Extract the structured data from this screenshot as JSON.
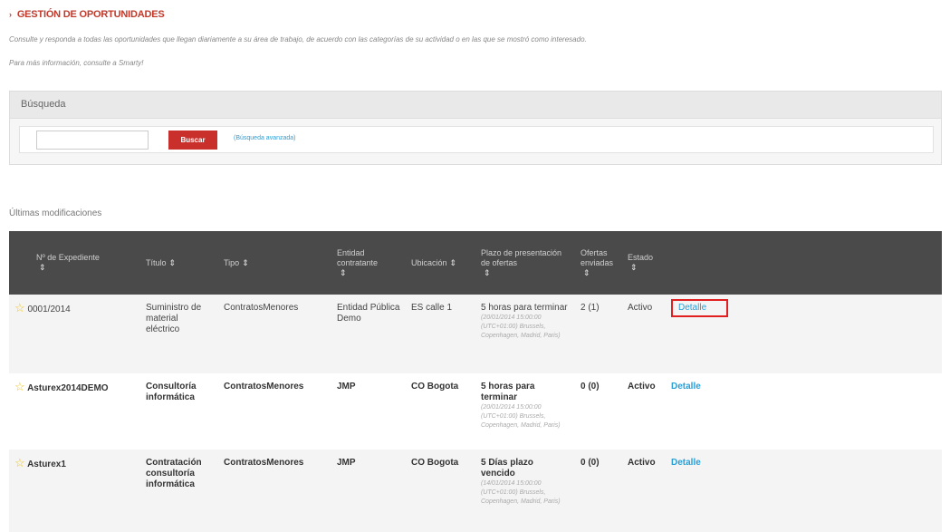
{
  "header": {
    "title": "GESTIÓN DE OPORTUNIDADES",
    "intro": "Consulte y responda a todas las oportunidades que llegan diariamente a su área de trabajo, de acuerdo con las categorías de su actividad o en las que se mostró como interesado.",
    "more_info": "Para más información, consulte a Smarty!"
  },
  "search": {
    "title": "Búsqueda",
    "input_value": "",
    "button_label": "Buscar",
    "advanced_link": "(Búsqueda avanzada)"
  },
  "recent": {
    "title": "Últimas modificaciones"
  },
  "table": {
    "headers": [
      "Nº de Expediente",
      "Título",
      "Tipo",
      "Entidad contratante",
      "Ubicación",
      "Plazo de presentación de ofertas",
      "Ofertas enviadas",
      "Estado"
    ],
    "sort_icon": "⇕",
    "star_icon": "☆",
    "rows": [
      {
        "expediente": "0001/2014",
        "titulo": "Suministro de material eléctrico",
        "tipo": "ContratosMenores",
        "entidad": "Entidad Pública Demo",
        "ubicacion": "ES calle 1",
        "plazo": "5 horas para terminar",
        "plazo_detalle": "(20/01/2014 15:00:00 (UTC+01:00) Brussels, Copenhagen, Madrid, Paris)",
        "ofertas": "2 (1)",
        "estado": "Activo",
        "detalle": "Detalle"
      },
      {
        "expediente": "Asturex2014DEMO",
        "titulo": "Consultoría informática",
        "tipo": "ContratosMenores",
        "entidad": "JMP",
        "ubicacion": "CO Bogota",
        "plazo": "5 horas para terminar",
        "plazo_detalle": "(20/01/2014 15:00:00 (UTC+01:00) Brussels, Copenhagen, Madrid, Paris)",
        "ofertas": "0 (0)",
        "estado": "Activo",
        "detalle": "Detalle"
      },
      {
        "expediente": "Asturex1",
        "titulo": "Contratación consultoría informática",
        "tipo": "ContratosMenores",
        "entidad": "JMP",
        "ubicacion": "CO Bogota",
        "plazo": "5 Días plazo vencido",
        "plazo_detalle": "(14/01/2014 15:00:00 (UTC+01:00) Brussels, Copenhagen, Madrid, Paris)",
        "ofertas": "0 (0)",
        "estado": "Activo",
        "detalle": "Detalle"
      }
    ]
  },
  "colors": {
    "accent_red": "#c0392b",
    "button_red": "#c9302c",
    "link_blue": "#2a9fd6",
    "header_dark": "#4a4a4a",
    "highlight_box": "#e02020"
  }
}
